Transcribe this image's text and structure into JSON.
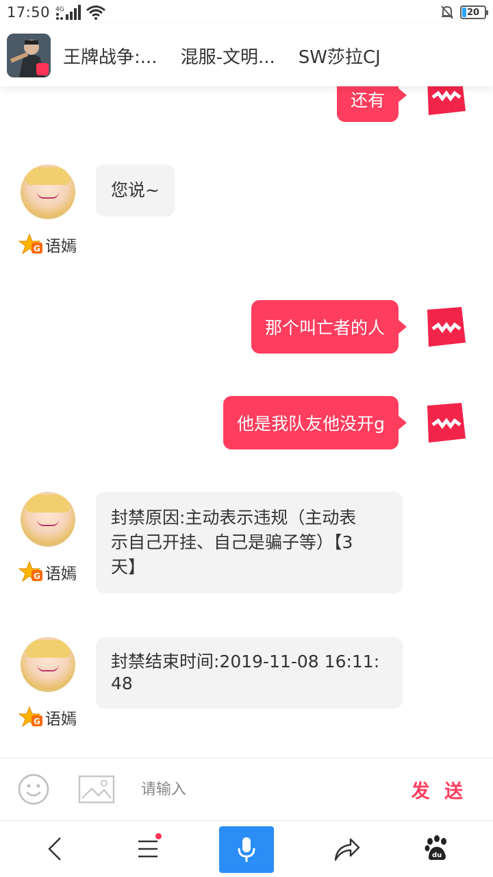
{
  "status_bar": {
    "time": "17:50",
    "network": "4G",
    "battery": "20"
  },
  "header": {
    "tabs": [
      "王牌战争:...",
      "混服-文明...",
      "SW莎拉CJ"
    ]
  },
  "messages": {
    "m1": "还有",
    "m2": "您说~",
    "m2_user": "语嫣",
    "m3": "那个叫亡者的人",
    "m4": "他是我队友他没开g",
    "m5_line1": "封禁原因:主动表示违规（主动表",
    "m5_line2": "示自己开挂、自己是骗子等）【3",
    "m5_line3": "天】",
    "m5_user": "语嫣",
    "m6_line1": "封禁结束时间:2019-11-08 16:11:",
    "m6_line2": "48",
    "m6_user": "语嫣"
  },
  "input": {
    "placeholder": "请输入",
    "send_label": "发 送"
  },
  "colors": {
    "accent": "#ff3d5e",
    "mic_blue": "#2b8ef7",
    "bubble_gray": "#f3f3f3"
  },
  "icons": {
    "emoji": "emoji-icon",
    "image": "image-icon",
    "back": "back-icon",
    "menu": "menu-icon",
    "mic": "mic-icon",
    "share": "share-icon",
    "baidu": "baidu-paw-icon"
  }
}
